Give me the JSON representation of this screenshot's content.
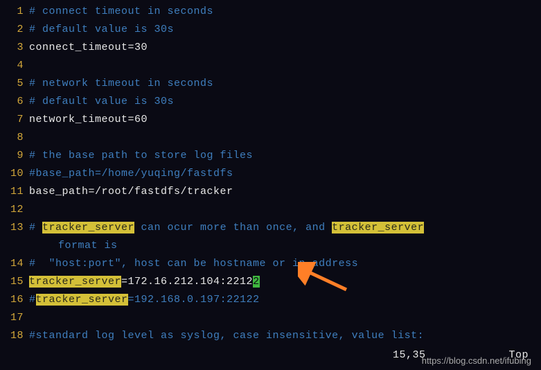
{
  "lines": {
    "l1": "# connect timeout in seconds",
    "l2": "# default value is 30s",
    "l3": "connect_timeout=30",
    "l5": "# network timeout in seconds",
    "l6": "# default value is 30s",
    "l7": "network_timeout=60",
    "l9": "# the base path to store log files",
    "l10": "#base_path=/home/yuqing/fastdfs",
    "l11": "base_path=/root/fastdfs/tracker",
    "l13a": "# ",
    "l13b": "tracker_server",
    "l13c": " can ocur more than once, and ",
    "l13d": "tracker_server",
    "l13e": "format is",
    "l14": "#  \"host:port\", host can be hostname or ip address",
    "l15a": "tracker_server",
    "l15b": "=172.16.212.104:2212",
    "l15c": "2",
    "l16a": "#",
    "l16b": "tracker_server",
    "l16c": "=192.168.0.197:22122",
    "l18": "#standard log level as syslog, case insensitive, value list:"
  },
  "gutter": {
    "n1": "1",
    "n2": "2",
    "n3": "3",
    "n4": "4",
    "n5": "5",
    "n6": "6",
    "n7": "7",
    "n8": "8",
    "n9": "9",
    "n10": "10",
    "n11": "11",
    "n12": "12",
    "n13": "13",
    "n14": "14",
    "n15": "15",
    "n16": "16",
    "n17": "17",
    "n18": "18"
  },
  "status": {
    "position": "15,35",
    "scroll": "Top"
  },
  "watermark": "https://blog.csdn.net/ifubing"
}
